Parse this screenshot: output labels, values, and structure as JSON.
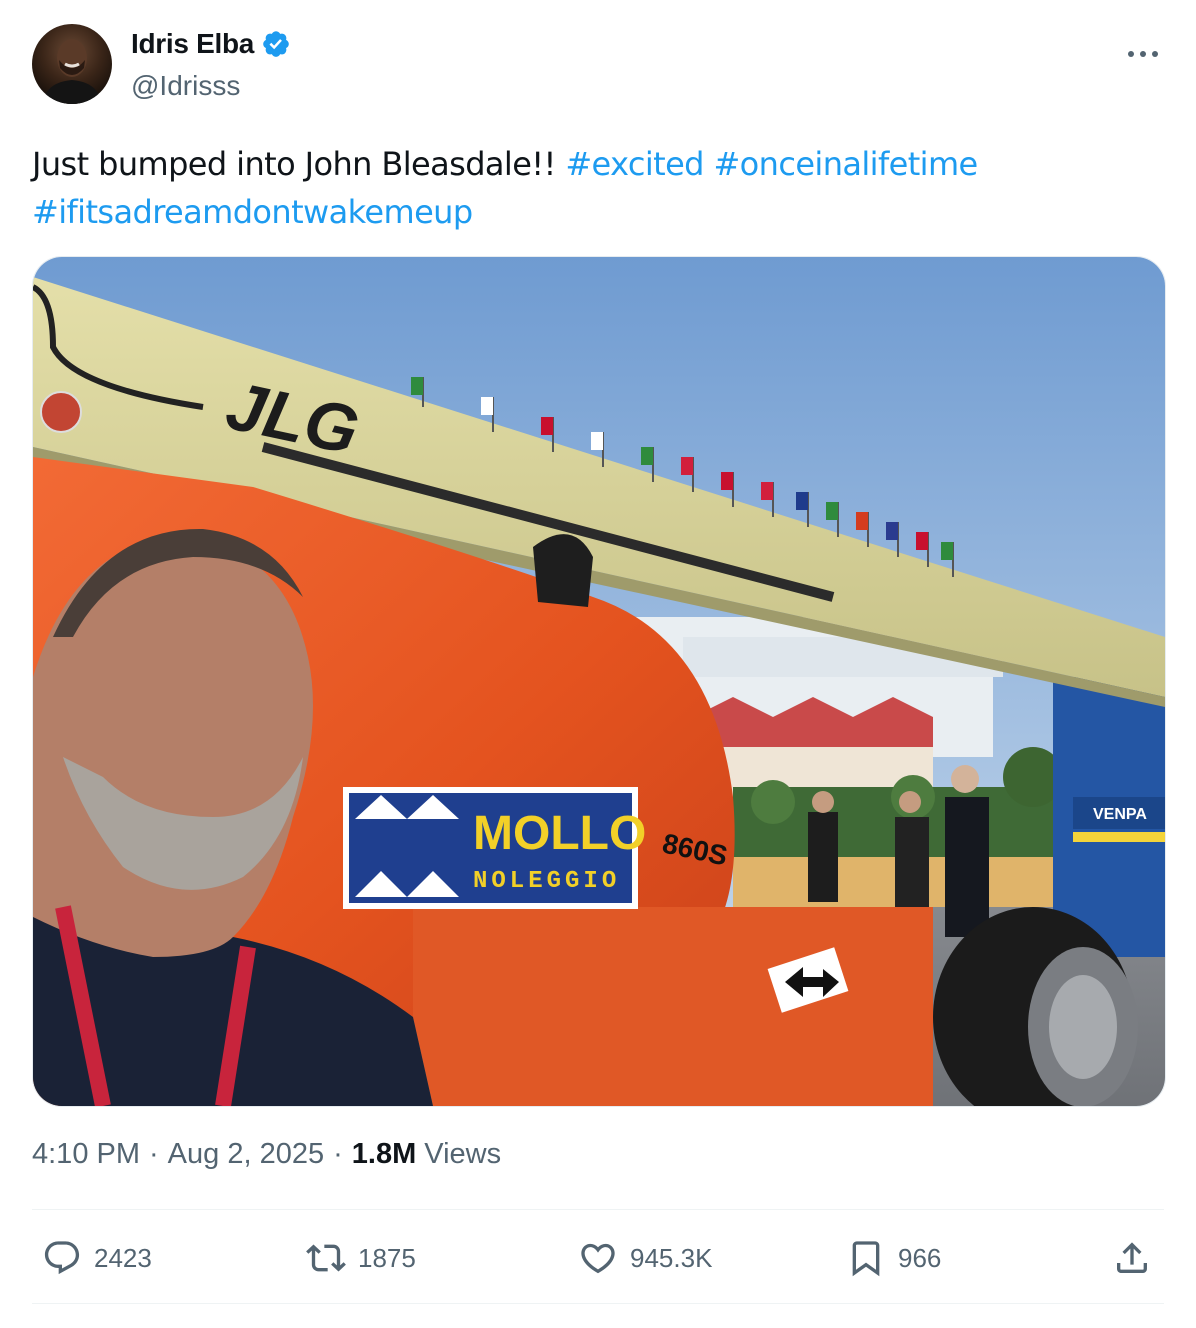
{
  "author": {
    "display_name": "Idris Elba",
    "handle": "@Idrisss",
    "verified": true,
    "verified_color": "#1d9bf0"
  },
  "tweet": {
    "text_plain": "Just bumped into John Bleasdale!! ",
    "hashtags": [
      "#excited",
      "#onceinalifetime",
      "#ifitsadreamdontwakemeup"
    ],
    "link_color": "#1d9bf0"
  },
  "media": {
    "boom_logo": "JLG",
    "brand_main": "MOLLO",
    "brand_sub": "NOLEGGIO",
    "model": "860S",
    "lift_brand": "VENPA"
  },
  "meta": {
    "time": "4:10 PM",
    "date": "Aug 2, 2025",
    "views_count": "1.8M",
    "views_label": "Views"
  },
  "actions": {
    "replies": "2423",
    "reposts": "1875",
    "likes": "945.3K",
    "bookmarks": "966"
  },
  "icons": [
    "more-icon",
    "verified-icon",
    "reply-icon",
    "repost-icon",
    "like-icon",
    "bookmark-icon",
    "share-icon"
  ]
}
